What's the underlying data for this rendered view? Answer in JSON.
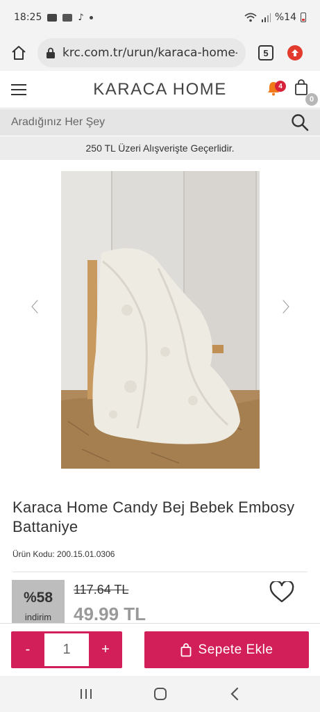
{
  "status_bar": {
    "time": "18:25",
    "battery": "%14"
  },
  "browser": {
    "url": "krc.com.tr/urun/karaca-home-c",
    "tab_count": "5"
  },
  "header": {
    "logo": "KARACA HOME",
    "notification_count": "4",
    "cart_count": "0"
  },
  "search": {
    "placeholder": "Aradığınız Her Şey"
  },
  "promo": {
    "text": "250 TL Üzeri Alışverişte Geçerlidir."
  },
  "product": {
    "title": "Karaca Home Candy Bej Bebek Embosy Battaniye",
    "code": "Ürün Kodu: 200.15.01.0306",
    "discount_value": "%58",
    "discount_label": "indirim",
    "old_price": "117.64 TL",
    "new_price": "49.99 TL"
  },
  "cart": {
    "minus": "-",
    "quantity": "1",
    "plus": "+",
    "add_label": "Sepete Ekle"
  },
  "colors": {
    "accent": "#d31f59",
    "badge": "#d8213b",
    "discount_bg": "#bdbdbd"
  }
}
